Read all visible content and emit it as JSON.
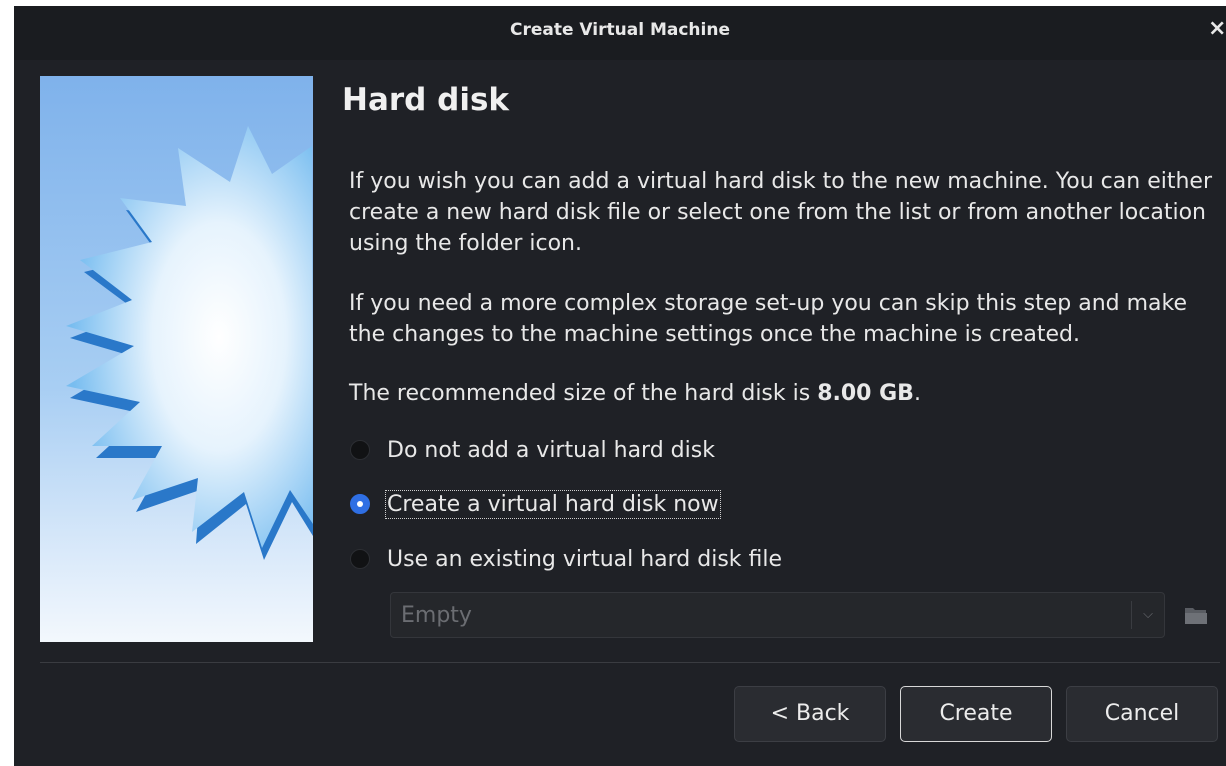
{
  "window": {
    "title": "Create Virtual Machine",
    "close_glyph": "×"
  },
  "page": {
    "heading": "Hard disk",
    "paragraph1": "If you wish you can add a virtual hard disk to the new machine. You can either create a new hard disk file or select one from the list or from another location using the folder icon.",
    "paragraph2": "If you need a more complex storage set-up you can skip this step and make the changes to the machine settings once the machine is created.",
    "recommended_prefix": "The recommended size of the hard disk is ",
    "recommended_size": "8.00 GB",
    "recommended_suffix": "."
  },
  "options": [
    {
      "label": "Do not add a virtual hard disk",
      "checked": false
    },
    {
      "label": "Create a virtual hard disk now",
      "checked": true
    },
    {
      "label": "Use an existing virtual hard disk file",
      "checked": false
    }
  ],
  "disk_selector": {
    "value": "Empty",
    "enabled": false,
    "arrow_glyph": "⌵"
  },
  "buttons": {
    "back": "< Back",
    "create": "Create",
    "cancel": "Cancel"
  },
  "colors": {
    "window_bg": "#1f2126",
    "accent": "#2f6fe4",
    "text": "#e8e8e8",
    "disabled_text": "#6b6d72"
  },
  "icons": [
    "close-icon",
    "wizard-banner-star",
    "radio-icon",
    "chevron-down-icon",
    "folder-icon"
  ]
}
